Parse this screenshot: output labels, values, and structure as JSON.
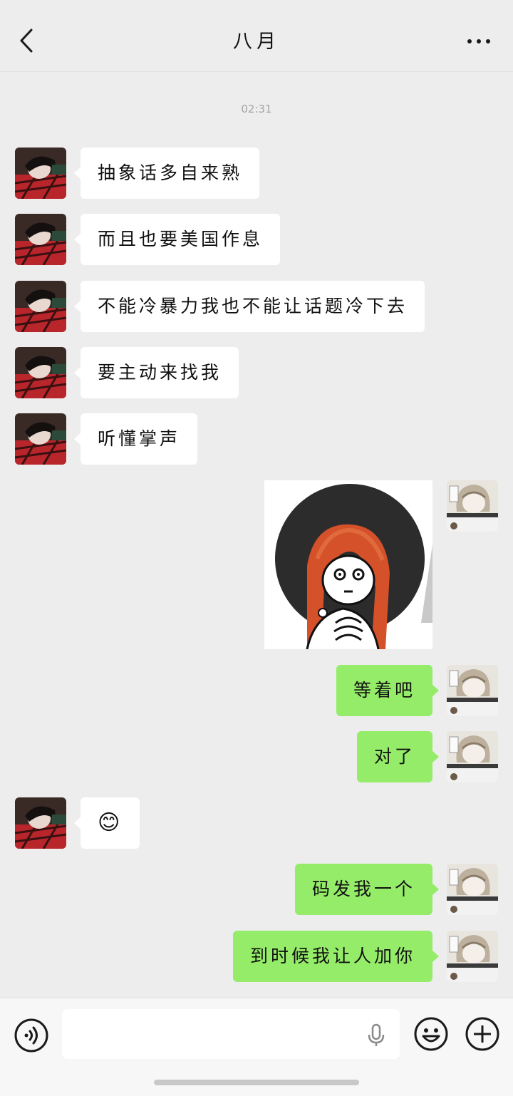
{
  "header": {
    "title": "八月"
  },
  "chat": {
    "timestamp": "02:31",
    "messages": [
      {
        "side": "left",
        "text": "抽象话多自来熟"
      },
      {
        "side": "left",
        "text": "而且也要美国作息"
      },
      {
        "side": "left",
        "text": "不能冷暴力我也不能让话题冷下去"
      },
      {
        "side": "left",
        "text": "要主动来找我"
      },
      {
        "side": "left",
        "text": "听懂掌声"
      },
      {
        "side": "right",
        "type": "sticker"
      },
      {
        "side": "right",
        "text": "等着吧"
      },
      {
        "side": "right",
        "text": "对了"
      },
      {
        "side": "left",
        "text": "😊"
      },
      {
        "side": "right",
        "text": "码发我一个"
      },
      {
        "side": "right",
        "text": "到时候我让人加你"
      }
    ]
  },
  "icons": {
    "back": "back-chevron-icon",
    "more": "more-dots-icon",
    "voice": "voice-input-icon",
    "mic": "microphone-icon",
    "emoji": "emoji-face-icon",
    "plus": "plus-icon"
  },
  "colors": {
    "background": "#ededed",
    "bubble_sent": "#95ec69",
    "bubble_received": "#ffffff"
  }
}
